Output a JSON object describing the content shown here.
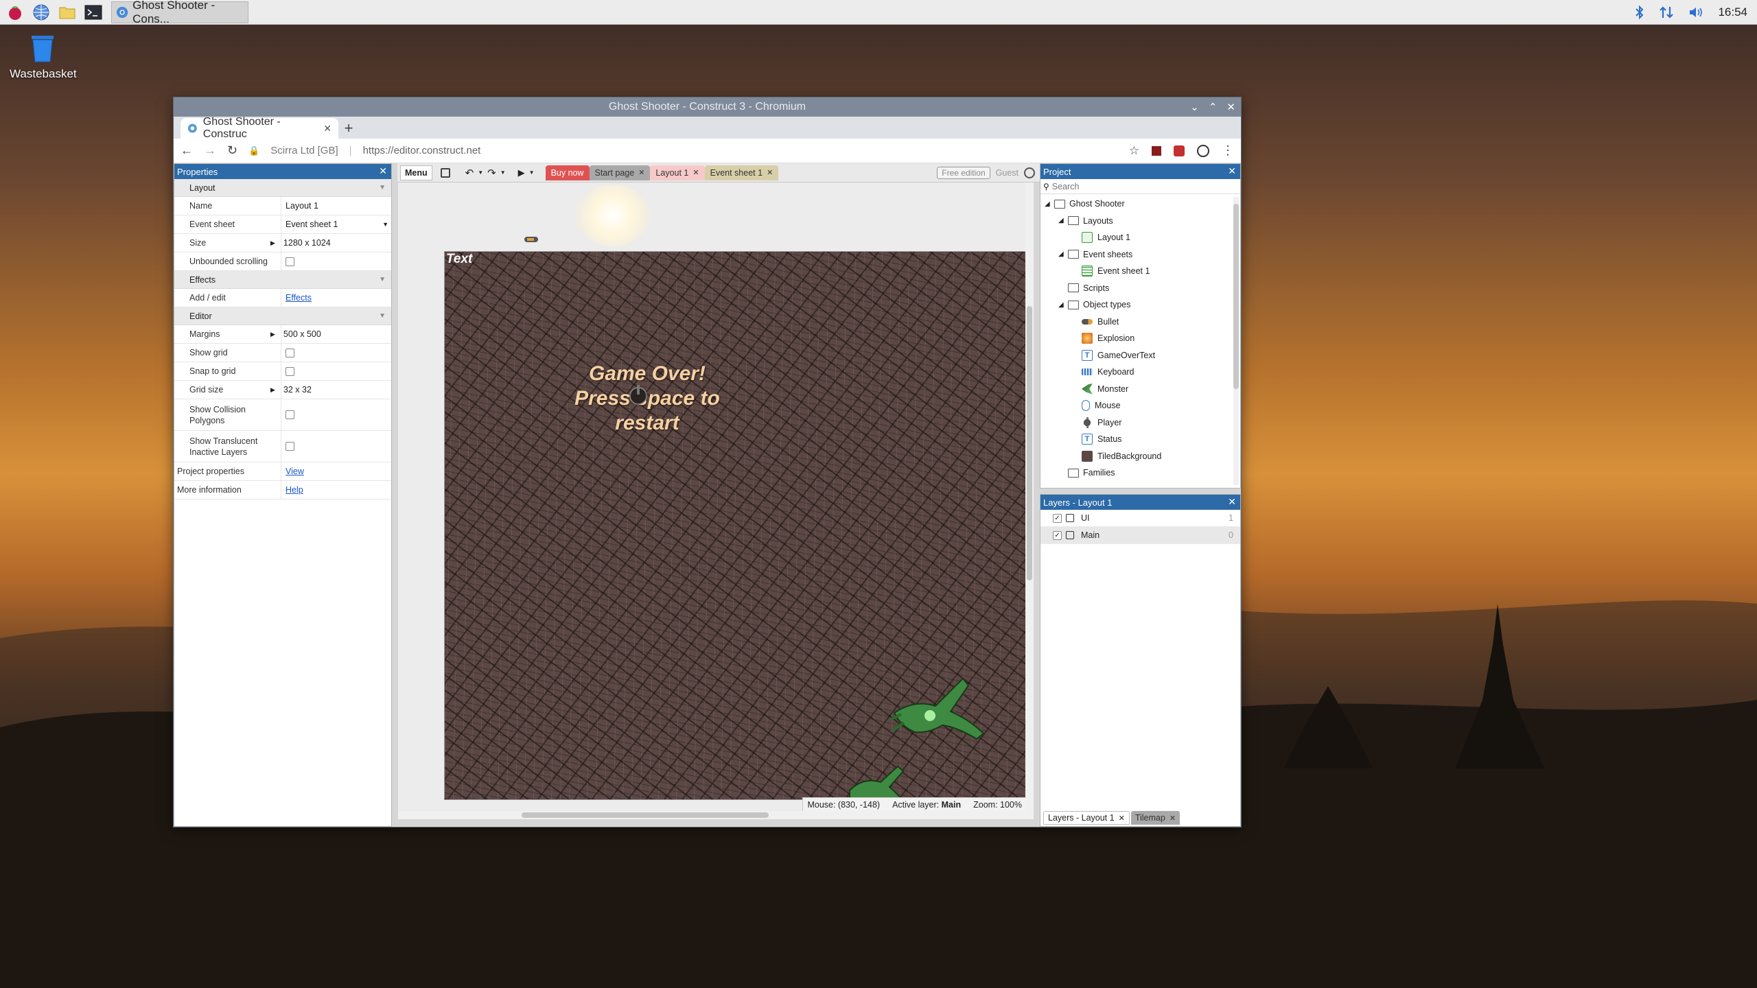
{
  "taskbar": {
    "task_title": "Ghost Shooter - Cons...",
    "clock": "16:54"
  },
  "desktop": {
    "wastebasket_label": "Wastebasket"
  },
  "window": {
    "title": "Ghost Shooter - Construct 3 - Chromium"
  },
  "browser": {
    "tab_title": "Ghost Shooter - Construc",
    "cert_owner": "Scirra Ltd [GB]",
    "url": "https://editor.construct.net"
  },
  "properties": {
    "header": "Properties",
    "cat_layout": "Layout",
    "name_key": "Name",
    "name_val": "Layout 1",
    "eventsheet_key": "Event sheet",
    "eventsheet_val": "Event sheet 1",
    "size_key": "Size",
    "size_val": "1280 x 1024",
    "unbounded_key": "Unbounded scrolling",
    "cat_effects": "Effects",
    "addedit_key": "Add / edit",
    "addedit_val": "Effects",
    "cat_editor": "Editor",
    "margins_key": "Margins",
    "margins_val": "500 x 500",
    "showgrid_key": "Show grid",
    "snap_key": "Snap to grid",
    "gridsize_key": "Grid size",
    "gridsize_val": "32 x 32",
    "collision_key": "Show Collision Polygons",
    "translucent_key": "Show Translucent Inactive Layers",
    "projprops_key": "Project properties",
    "projprops_val": "View",
    "moreinfo_key": "More information",
    "moreinfo_val": "Help"
  },
  "toolbar": {
    "menu": "Menu",
    "buy_now": "Buy now",
    "start_page": "Start page",
    "layout_tab": "Layout 1",
    "eventsheet_tab": "Event sheet 1",
    "free_edition": "Free edition",
    "guest": "Guest"
  },
  "layout_view": {
    "text_object": "Text",
    "game_over_line1": "Game Over!",
    "game_over_line2": "Press space to",
    "game_over_line3": "restart",
    "mouse": "Mouse: (830, -148)",
    "active_layer_label": "Active layer:",
    "active_layer_val": "Main",
    "zoom": "Zoom: 100%"
  },
  "project": {
    "header": "Project",
    "search_placeholder": "Search",
    "root": "Ghost Shooter",
    "layouts": "Layouts",
    "layout1": "Layout 1",
    "eventsheets": "Event sheets",
    "eventsheet1": "Event sheet 1",
    "scripts": "Scripts",
    "objecttypes": "Object types",
    "objects": [
      "Bullet",
      "Explosion",
      "GameOverText",
      "Keyboard",
      "Monster",
      "Mouse",
      "Player",
      "Status",
      "TiledBackground"
    ],
    "families": "Families"
  },
  "layers": {
    "header": "Layers - Layout 1",
    "rows": [
      {
        "name": "UI",
        "num": "1"
      },
      {
        "name": "Main",
        "num": "0"
      }
    ],
    "tab1": "Layers - Layout 1",
    "tab2": "Tilemap"
  },
  "colors": {
    "panel_header": "#2c6aa8",
    "buy_now": "#e05252",
    "layout_tab": "#f7c9c9",
    "eventsheet_tab": "#d8cfa8"
  }
}
